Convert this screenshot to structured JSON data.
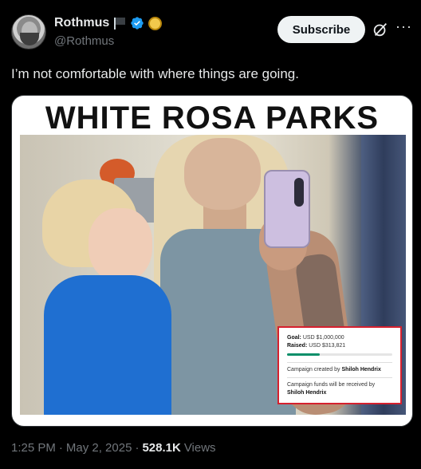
{
  "author": {
    "display_name": "Rothmus",
    "handle": "@Rothmus",
    "verified_color": "#1d9bf0"
  },
  "actions": {
    "subscribe_label": "Subscribe"
  },
  "post": {
    "text": "I’m not comfortable with where things are going.",
    "media": {
      "headline": "WHITE ROSA PARKS",
      "campaign": {
        "goal_label": "Goal:",
        "goal_value": "USD $1,000,000",
        "raised_label": "Raised:",
        "raised_value": "USD $313,821",
        "progress_fraction": 0.314,
        "created_by_text": "Campaign created by",
        "created_by_name": "Shiloh Hendrix",
        "received_by_text": "Campaign funds will be received by",
        "received_by_name": "Shiloh Hendrix"
      }
    }
  },
  "meta": {
    "time": "1:25 PM",
    "date": "May 2, 2025",
    "views_count": "528.1K",
    "views_label": "Views",
    "separator": "·"
  }
}
